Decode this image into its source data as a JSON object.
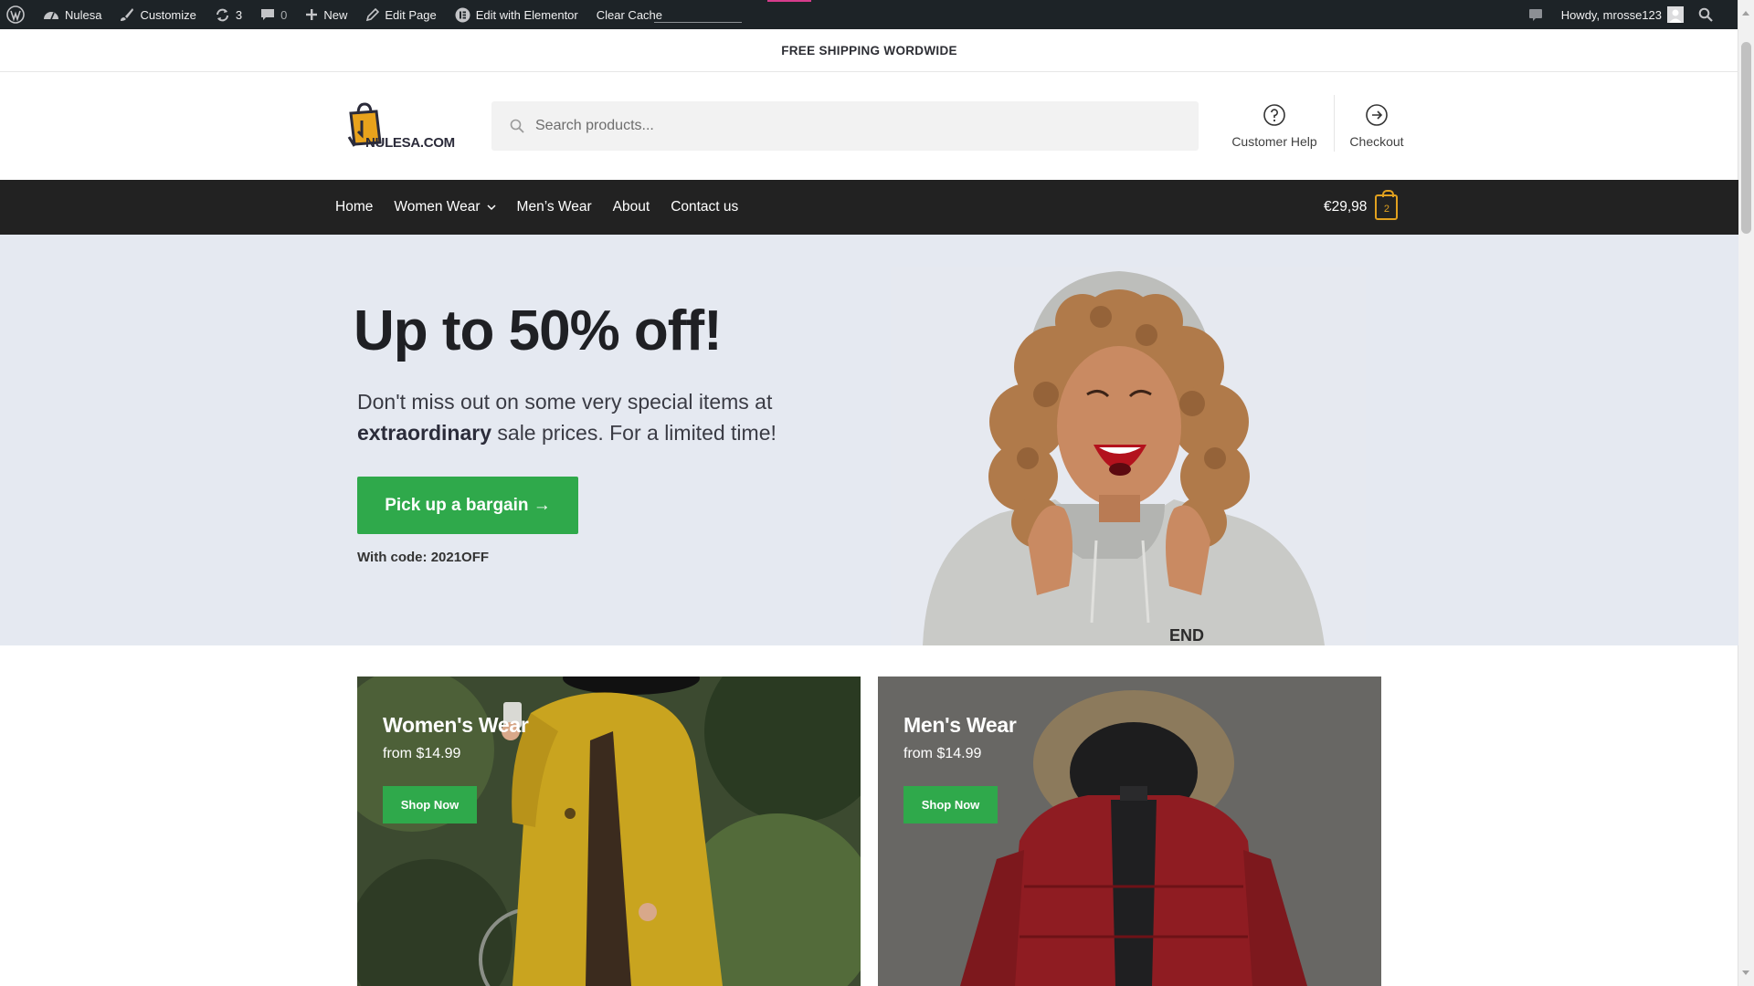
{
  "admin_bar": {
    "site_name": "Nulesa",
    "customize": "Customize",
    "updates_count": "3",
    "comments_count": "0",
    "new_label": "New",
    "edit_page": "Edit Page",
    "edit_elementor": "Edit with Elementor",
    "clear_cache": "Clear Cache",
    "greeting": "Howdy, mrosse123"
  },
  "notice": "FREE SHIPPING WORDWIDE",
  "logo_text": "NULESA.COM",
  "search": {
    "placeholder": "Search products..."
  },
  "header_links": {
    "help": "Customer Help",
    "checkout": "Checkout"
  },
  "nav": {
    "items": [
      "Home",
      "Women Wear",
      "Men’s Wear",
      "About",
      "Contact us"
    ]
  },
  "cart": {
    "total": "€29,98",
    "count": "2"
  },
  "hero": {
    "title": "Up to 50% off!",
    "sub_before": "Don't miss out on some very special items at ",
    "sub_bold": "extraordinary",
    "sub_after": " sale prices. For a limited time!",
    "cta": "Pick up a bargain →",
    "code": "With code: 2021OFF"
  },
  "categories": [
    {
      "title": "Women's Wear",
      "from": "from $14.99",
      "button": "Shop Now"
    },
    {
      "title": "Men's Wear",
      "from": "from $14.99",
      "button": "Shop Now"
    }
  ],
  "colors": {
    "admin_bar": "#1d2327",
    "navbar": "#222222",
    "hero_bg": "#e5e9f1",
    "accent_green": "#2fa94b",
    "cart_badge": "#e1a11f"
  }
}
